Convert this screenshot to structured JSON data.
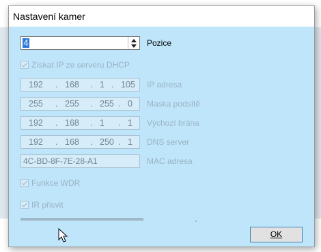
{
  "dialog": {
    "title": "Nastavení kamer"
  },
  "position": {
    "value": "4",
    "label": "Pozice"
  },
  "dhcp": {
    "label": "Získat IP ze serveru DHCP",
    "checked": true
  },
  "ip_address": {
    "octets": [
      "192",
      "168",
      "1",
      "105"
    ],
    "label": "IP adresa"
  },
  "subnet_mask": {
    "octets": [
      "255",
      "255",
      "255",
      "0"
    ],
    "label": "Maska podsítě"
  },
  "gateway": {
    "octets": [
      "192",
      "168",
      "1",
      "1"
    ],
    "label": "Výchozí brána"
  },
  "dns": {
    "octets": [
      "192",
      "168",
      "250",
      "1"
    ],
    "label": "DNS server"
  },
  "mac": {
    "value": "4C-BD-8F-7E-28-A1",
    "label": "MAC adresa"
  },
  "wdr": {
    "label": "Funkce WDR",
    "checked": true
  },
  "ir": {
    "label": "IR přisvit",
    "checked": true
  },
  "ok_button": {
    "label": "OK"
  },
  "colors": {
    "client_bg": "#bfe5fa",
    "disabled_text": "#9ab3c4",
    "selection": "#2b79d8"
  }
}
